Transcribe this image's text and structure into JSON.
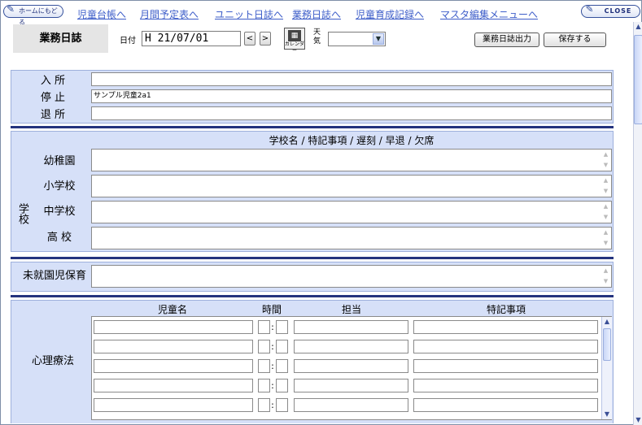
{
  "nav": {
    "home_label": "ホームにもどる",
    "close_label": "CLOSE",
    "links": [
      "児童台帳へ",
      "月間予定表へ",
      "ユニット日誌へ",
      "業務日誌へ",
      "児童育成記録へ",
      "マスタ編集メニューへ"
    ]
  },
  "header": {
    "title": "業務日誌",
    "date_label": "日付",
    "date_value": "H 21/07/01",
    "prev_label": "<",
    "next_label": ">",
    "calendar_label": "カレンダー",
    "weather_label": "天気",
    "weather_value": "",
    "print_button": "業務日誌出力",
    "save_button": "保存する"
  },
  "attendance": {
    "rows": [
      {
        "label": "入 所",
        "value": ""
      },
      {
        "label": "停 止",
        "value": "サンプル児童2a1"
      },
      {
        "label": "退 所",
        "value": ""
      }
    ]
  },
  "school": {
    "group_label": "学校",
    "column_header": "学校名 / 特記事項 / 遅刻 / 早退 / 欠席",
    "rows": [
      {
        "label": "幼稚園",
        "value": ""
      },
      {
        "label": "小学校",
        "value": ""
      },
      {
        "label": "中学校",
        "value": ""
      },
      {
        "label": "高 校",
        "value": ""
      }
    ]
  },
  "preschool": {
    "label": "未就園児保育",
    "value": ""
  },
  "therapy": {
    "label": "心理療法",
    "columns": [
      "児童名",
      "時間",
      "担当",
      "特記事項"
    ],
    "row_count": 5
  }
}
